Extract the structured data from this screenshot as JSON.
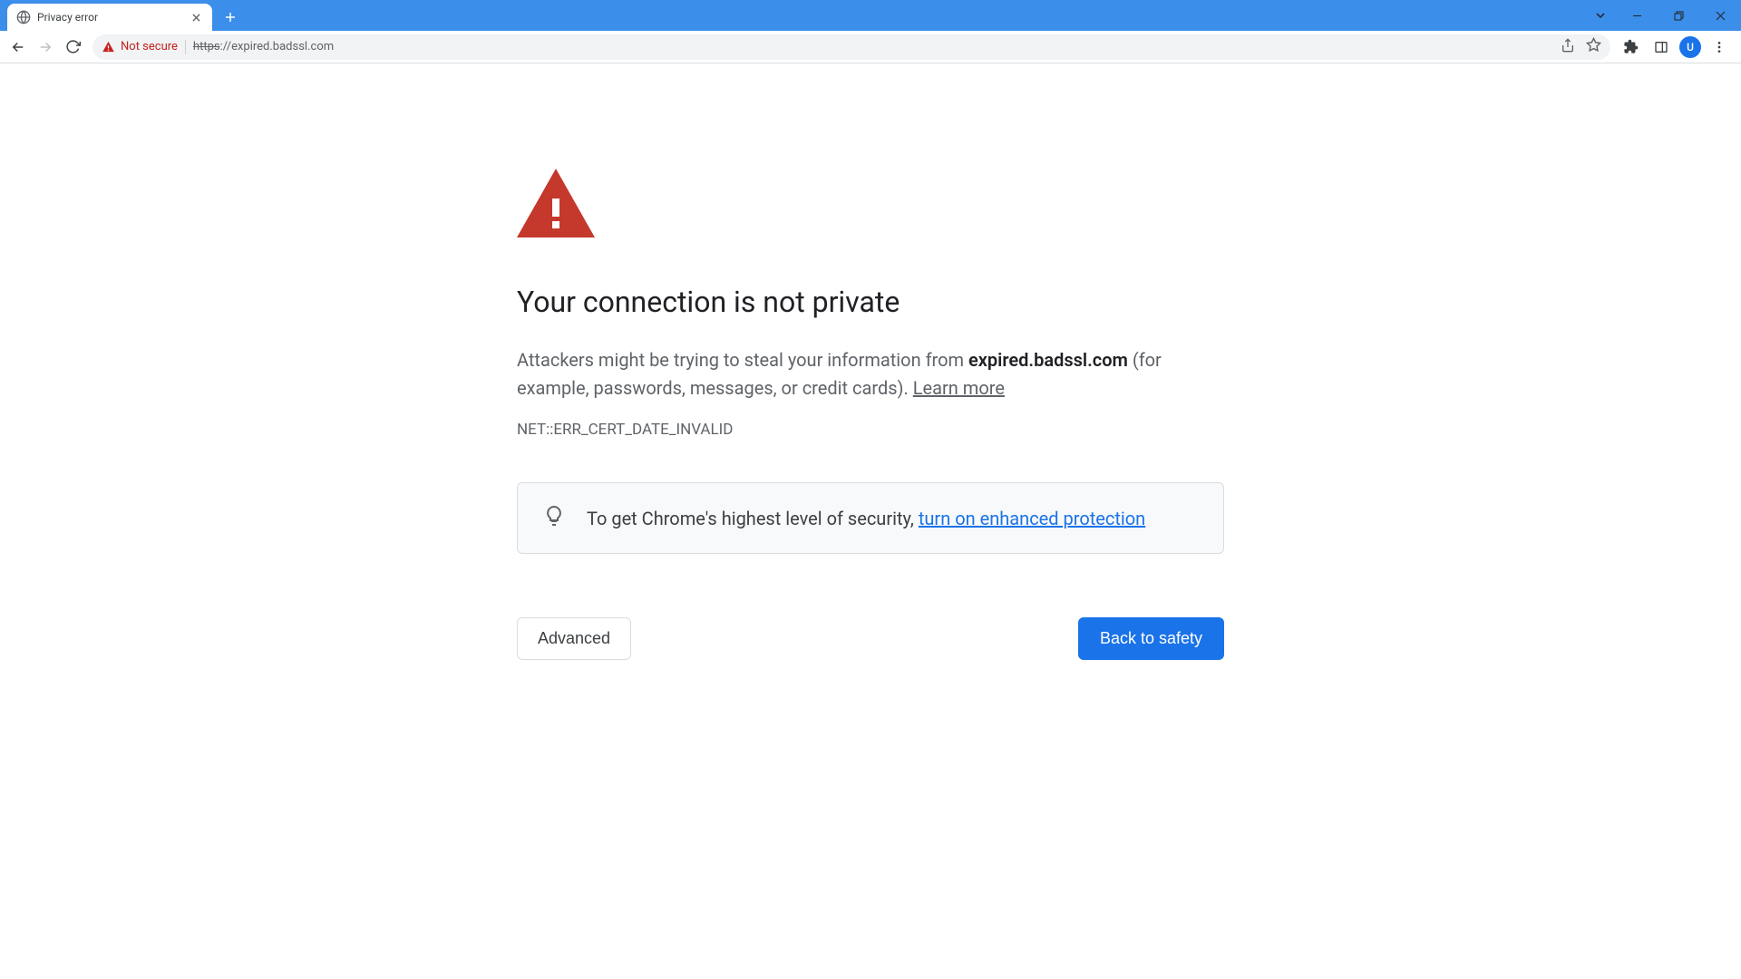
{
  "tab": {
    "title": "Privacy error"
  },
  "omnibox": {
    "security_text": "Not secure",
    "url_protocol": "https",
    "url_rest": "://expired.badssl.com"
  },
  "avatar": {
    "initial": "U"
  },
  "page": {
    "title": "Your connection is not private",
    "msg_prefix": "Attackers might be trying to steal your information from ",
    "msg_domain": "expired.badssl.com",
    "msg_suffix": " (for example, passwords, messages, or credit cards). ",
    "learn_more": "Learn more",
    "error_code": "NET::ERR_CERT_DATE_INVALID",
    "tip_text": "To get Chrome's highest level of security, ",
    "tip_link": "turn on enhanced protection",
    "advanced_label": "Advanced",
    "safety_label": "Back to safety"
  }
}
